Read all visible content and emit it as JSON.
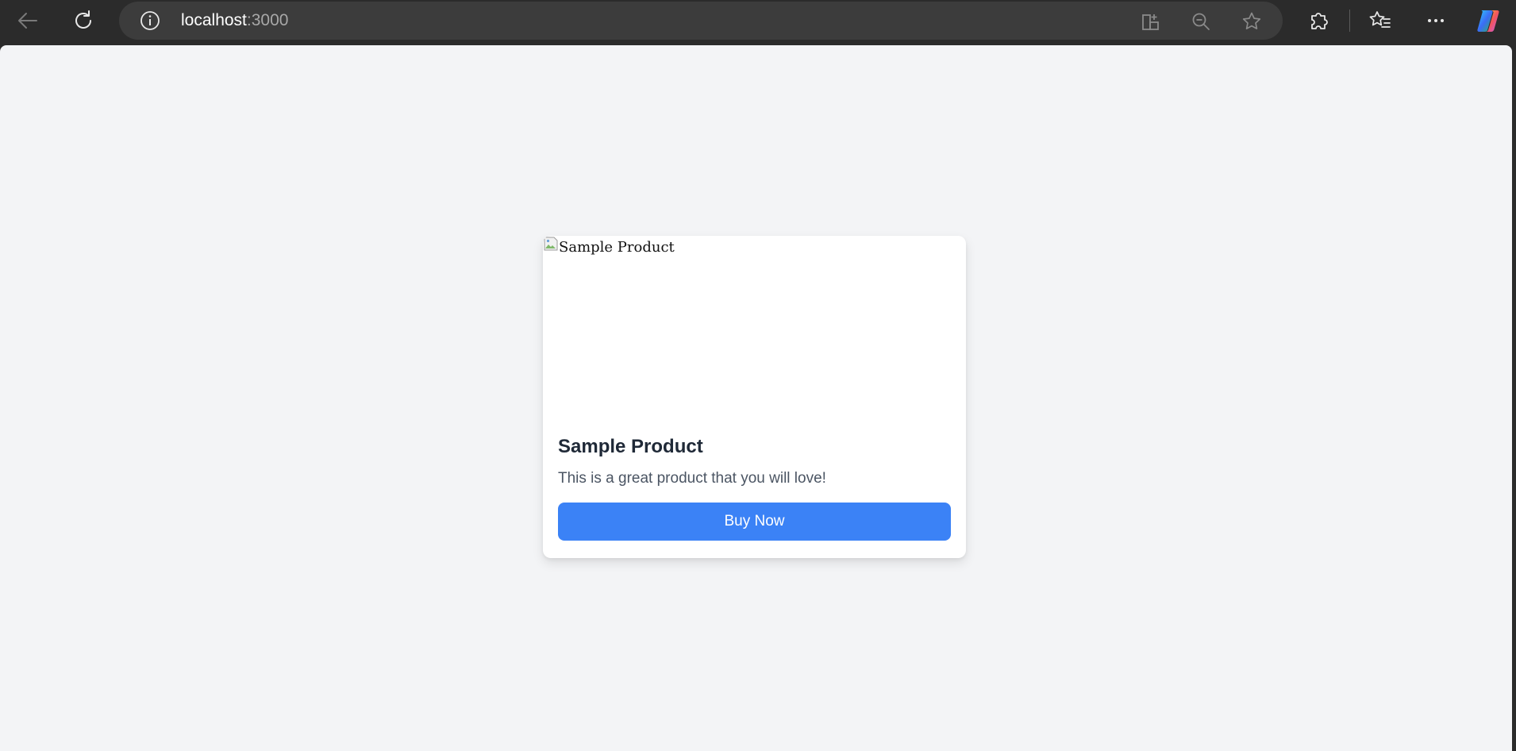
{
  "browser": {
    "url_host": "localhost",
    "url_port": ":3000",
    "icons": {
      "back": "back-arrow-icon",
      "reload": "reload-icon",
      "site_info": "info-icon",
      "split_screen": "split-screen-icon",
      "zoom": "zoom-out-icon",
      "favorite": "star-icon",
      "extensions": "puzzle-icon",
      "favorites_list": "favorites-icon",
      "more": "more-icon",
      "copilot": "copilot-icon"
    }
  },
  "product": {
    "image_alt": "Sample Product",
    "title": "Sample Product",
    "description": "This is a great product that you will love!",
    "button_label": "Buy Now"
  },
  "colors": {
    "page_background": "#f3f4f6",
    "button": "#3b82f6",
    "browser_chrome": "#2b2b2b"
  }
}
